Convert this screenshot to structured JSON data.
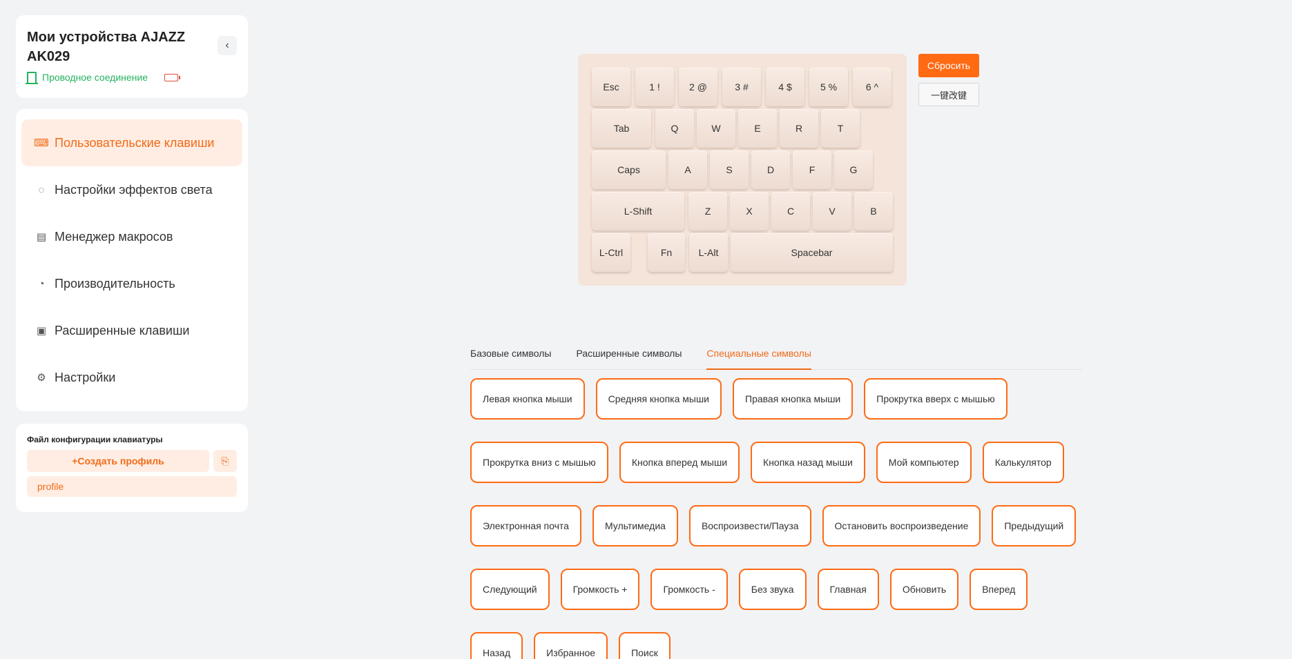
{
  "device": {
    "title": "Мои устройства AJAZZ AK029",
    "connection": "Проводное соединение"
  },
  "nav": [
    {
      "label": "Пользовательские клавиши",
      "icon": "custom-keys-icon",
      "active": true
    },
    {
      "label": "Настройки эффектов света",
      "icon": "bulb-icon",
      "active": false
    },
    {
      "label": "Менеджер макросов",
      "icon": "macro-icon",
      "active": false
    },
    {
      "label": "Производительность",
      "icon": "gauge-icon",
      "active": false
    },
    {
      "label": "Расширенные клавиши",
      "icon": "advanced-key-icon",
      "active": false
    },
    {
      "label": "Настройки",
      "icon": "gear-icon",
      "active": false
    }
  ],
  "profiles": {
    "title": "Файл конфигурации клавиатуры",
    "create_label": "+Создать профиль",
    "items": [
      "profile"
    ]
  },
  "keyboard": {
    "rows": [
      [
        "Esc",
        "1 !",
        "2 @",
        "3 #",
        "4 $",
        "5 %",
        "6 ^"
      ],
      [
        "Tab",
        "Q",
        "W",
        "E",
        "R",
        "T"
      ],
      [
        "Caps",
        "A",
        "S",
        "D",
        "F",
        "G"
      ],
      [
        "L-Shift",
        "Z",
        "X",
        "C",
        "V",
        "B"
      ],
      [
        "L-Ctrl",
        "Fn",
        "L-Alt",
        "Spacebar"
      ]
    ]
  },
  "actions": {
    "reset_label": "Сбросить",
    "onekey_label": "一键改键"
  },
  "tabs": [
    {
      "label": "Базовые символы",
      "active": false
    },
    {
      "label": "Расширенные символы",
      "active": false
    },
    {
      "label": "Специальные символы",
      "active": true
    }
  ],
  "special_keys": [
    [
      "Левая кнопка мыши",
      "Средняя кнопка мыши",
      "Правая кнопка мыши",
      "Прокрутка вверх с мышью"
    ],
    [
      "Прокрутка вниз с мышью",
      "Кнопка вперед мыши",
      "Кнопка назад мыши",
      "Мой компьютер",
      "Калькулятор"
    ],
    [
      "Электронная почта",
      "Мультимедиа",
      "Воспроизвести/Пауза",
      "Остановить воспроизведение",
      "Предыдущий"
    ],
    [
      "Следующий",
      "Громкость +",
      "Громкость -",
      "Без звука",
      "Главная",
      "Обновить",
      "Вперед"
    ],
    [
      "Назад",
      "Избранное",
      "Поиск"
    ]
  ],
  "colors": {
    "accent": "#ff6a13",
    "accent_soft": "#ffede3",
    "connection": "#22b35e",
    "battery_low": "#e04a3a"
  }
}
